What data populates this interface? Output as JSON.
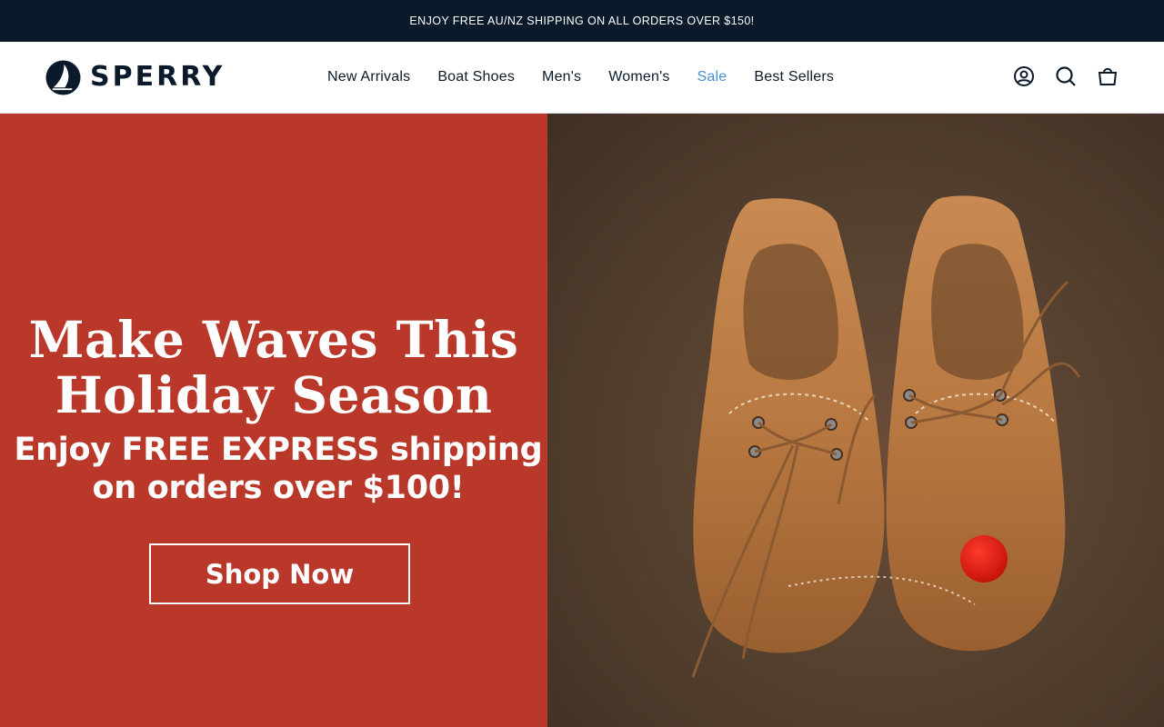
{
  "announcement": {
    "text": "ENJOY FREE AU/NZ SHIPPING ON ALL ORDERS OVER $150!"
  },
  "brand": {
    "name": "SPERRY"
  },
  "nav": {
    "items": [
      {
        "label": "New Arrivals"
      },
      {
        "label": "Boat Shoes"
      },
      {
        "label": "Men's"
      },
      {
        "label": "Women's"
      },
      {
        "label": "Sale"
      },
      {
        "label": "Best Sellers"
      }
    ]
  },
  "header_icons": [
    "account-icon",
    "search-icon",
    "cart-icon"
  ],
  "hero": {
    "heading_line1": "Make Waves This",
    "heading_line2": "Holiday Season",
    "sub_line1": "Enjoy FREE EXPRESS shipping",
    "sub_line2": "on orders over $100!",
    "cta_label": "Shop Now",
    "image": "boat-shoes-photo"
  },
  "colors": {
    "announcement_bg": "#0b1a2b",
    "brand_navy": "#0b1a2b",
    "sale_link": "#4a8fd6",
    "hero_red": "#b9382a"
  }
}
